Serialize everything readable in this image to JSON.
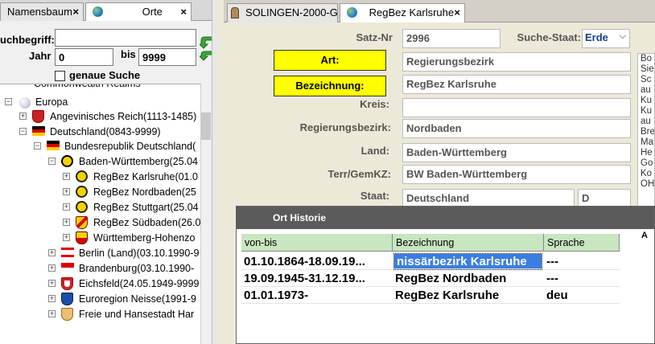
{
  "left_tabs": [
    {
      "label": "Namensbaum",
      "close": "×"
    },
    {
      "label": "Orte",
      "close": "×"
    }
  ],
  "search": {
    "label_suchbegriff": "uchbegriff:",
    "suchbegriff_value": "",
    "label_jahr": "Jahr",
    "jahr_from": "0",
    "label_bis": "bis",
    "jahr_to": "9999",
    "genaue_suche": "genaue Suche"
  },
  "tree": [
    {
      "text": "Commonwealth Realms"
    },
    {
      "text": "Europa"
    },
    {
      "text": "Angevinisches Reich(1113-1485)"
    },
    {
      "text": "Deutschland(0843-9999)"
    },
    {
      "text": "Bundesrepublik Deutschland("
    },
    {
      "text": "Baden-Württemberg(25.04"
    },
    {
      "text": "RegBez Karlsruhe(01.0"
    },
    {
      "text": "RegBez Nordbaden(25"
    },
    {
      "text": "RegBez Stuttgart(25.04"
    },
    {
      "text": "RegBez Südbaden(26.0"
    },
    {
      "text": "Württemberg-Hohenzo"
    },
    {
      "text": "Berlin (Land)(03.10.1990-9"
    },
    {
      "text": "Brandenburg(03.10.1990-"
    },
    {
      "text": "Eichsfeld(24.05.1949-9999"
    },
    {
      "text": "Euroregion Neisse(1991-9"
    },
    {
      "text": "Freie und Hansestadt Har"
    }
  ],
  "right_tabs": [
    {
      "label": "SOLINGEN-2000-G"
    },
    {
      "label": "RegBez Karlsruhe",
      "close": "×"
    }
  ],
  "form": {
    "satz_nr_label": "Satz-Nr",
    "satz_nr": "2996",
    "suche_staat_label": "Suche-Staat:",
    "suche_staat": "Erde",
    "art_button": "Art:",
    "art": "Regierungsbezirk",
    "bezeichnung_button": "Bezeichnung:",
    "bezeichnung": "RegBez Karlsruhe",
    "kreis_label": "Kreis:",
    "kreis": "",
    "regbez_label": "Regierungsbezirk:",
    "regbez": "Nordbaden",
    "land_label": "Land:",
    "land": "Baden-Württemberg",
    "terr_label": "Terr/GemKZ:",
    "terr": "BW  Baden-Württemberg",
    "staat_label": "Staat:",
    "staat": "Deutschland",
    "staat_code": "D"
  },
  "side_list": [
    "Bo",
    "Sie",
    "Sc",
    "au",
    "Ku",
    "Ku",
    "au",
    "Bre",
    "Ma",
    "He",
    "Go",
    "Ko",
    "OH"
  ],
  "historie": {
    "title": "Ort Historie",
    "headers": [
      "von-bis",
      "Bezeichnung",
      "Sprache"
    ],
    "rows": [
      [
        "01.10.1864-18.09.19...",
        "nissärbezirk Karlsruhe",
        "---"
      ],
      [
        "19.09.1945-31.12.19...",
        "RegBez Nordbaden",
        "---"
      ],
      [
        "01.01.1973-",
        "RegBez Karlsruhe",
        "deu"
      ]
    ],
    "side_mark": "A"
  }
}
